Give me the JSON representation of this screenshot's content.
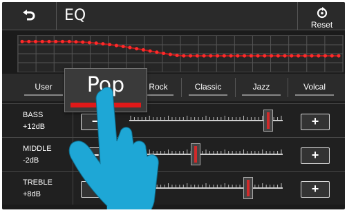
{
  "header": {
    "title": "EQ",
    "reset_label": "Reset"
  },
  "presets": [
    "User",
    "Pop",
    "Rock",
    "Classic",
    "Jazz",
    "Volcal"
  ],
  "selected_preset": "Pop",
  "popup_label": "Pop",
  "bands": [
    {
      "name": "BASS",
      "value": "+12dB",
      "level": 0.9
    },
    {
      "name": "MIDDLE",
      "value": "-2dB",
      "level": 0.43
    },
    {
      "name": "TREBLE",
      "value": "+8dB",
      "level": 0.77
    }
  ],
  "button_minus": "−",
  "button_plus": "+",
  "colors": {
    "accent": "#e01919",
    "background": "#1b1b1b",
    "hand": "#1ea7d6"
  }
}
